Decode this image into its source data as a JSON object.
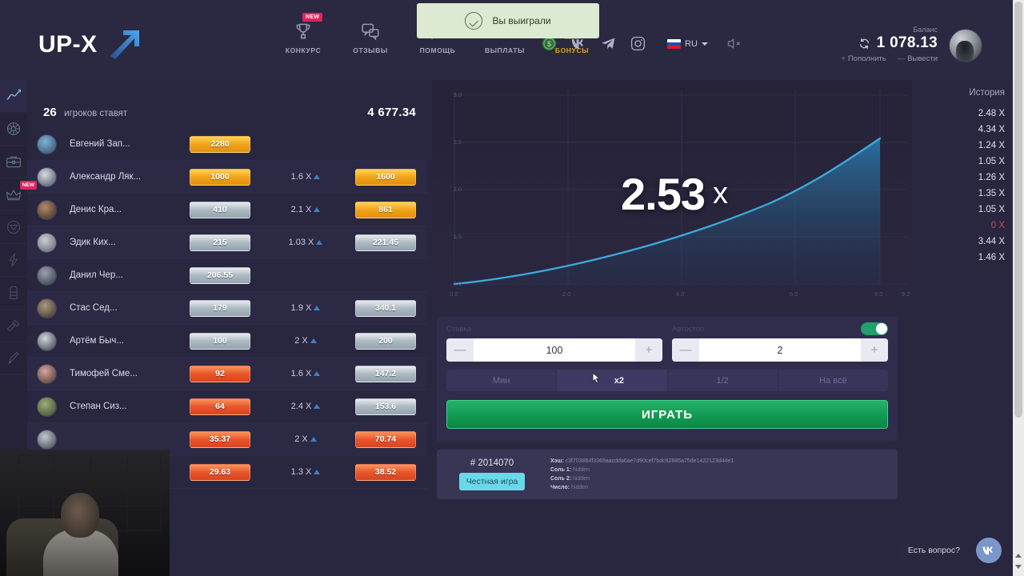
{
  "brand": {
    "name": "UP-X",
    "arrow_icon": "arrow-up-right-icon"
  },
  "toast": {
    "icon": "check-circle-icon",
    "message": "Вы выиграли"
  },
  "nav": {
    "items": [
      {
        "label": "КОНКУРС",
        "icon": "trophy-icon",
        "badge": "NEW",
        "active": false
      },
      {
        "label": "ОТЗЫВЫ",
        "icon": "chat-bubbles-icon",
        "badge": "",
        "active": false
      },
      {
        "label": "ПОМОЩЬ",
        "icon": "question-bubble-icon",
        "badge": "",
        "active": false
      },
      {
        "label": "ВЫПЛАТЫ",
        "icon": "cash-icon",
        "badge": "",
        "active": false
      },
      {
        "label": "БОНУСЫ",
        "icon": "gift-icon",
        "badge": "",
        "active": true
      }
    ],
    "social": [
      {
        "name": "money-coin-icon"
      },
      {
        "name": "vk-icon"
      },
      {
        "name": "telegram-icon"
      },
      {
        "name": "instagram-icon"
      }
    ],
    "language": {
      "code": "RU",
      "flag": "ru-flag-icon",
      "chevron": "chevron-down-icon"
    },
    "sound": {
      "icon": "sound-muted-icon"
    }
  },
  "account": {
    "balance_label": "Баланс",
    "balance_value": "1 078.13",
    "refresh_icon": "refresh-icon",
    "deposit_label": "Пополнить",
    "deposit_sign": "+",
    "withdraw_label": "Вывести",
    "withdraw_sign": "—",
    "avatar": "user-avatar"
  },
  "rail": {
    "items": [
      {
        "name": "crash-game",
        "icon": "chart-line-icon",
        "active": true,
        "badge": ""
      },
      {
        "name": "wheel-game",
        "icon": "wheel-icon",
        "active": false,
        "badge": ""
      },
      {
        "name": "case-game",
        "icon": "briefcase-icon",
        "active": false,
        "badge": ""
      },
      {
        "name": "crown-game",
        "icon": "crown-icon",
        "active": false,
        "badge": "NEW"
      },
      {
        "name": "diamond-game",
        "icon": "diamond-icon",
        "active": false,
        "badge": ""
      },
      {
        "name": "lightning-game",
        "icon": "lightning-icon",
        "active": false,
        "badge": ""
      },
      {
        "name": "tower-game",
        "icon": "tower-icon",
        "active": false,
        "badge": ""
      },
      {
        "name": "hammer-game",
        "icon": "hammer-icon",
        "active": false,
        "badge": ""
      },
      {
        "name": "rocket-game",
        "icon": "rocket-icon",
        "active": false,
        "badge": ""
      }
    ]
  },
  "players": {
    "count": "26",
    "count_label": "игроков ставят",
    "total": "4 677.34",
    "rows": [
      {
        "name": "Евгений Зап...",
        "bet": "2280",
        "bet_color": "gold",
        "mult": "",
        "win": "",
        "win_color": ""
      },
      {
        "name": "Александр Ляк...",
        "bet": "1000",
        "bet_color": "gold",
        "mult": "1.6 X",
        "win": "1600",
        "win_color": "gold"
      },
      {
        "name": "Денис Кра...",
        "bet": "410",
        "bet_color": "silver",
        "mult": "2.1 X",
        "win": "861",
        "win_color": "gold"
      },
      {
        "name": "Эдик Ких...",
        "bet": "215",
        "bet_color": "silver",
        "mult": "1.03 X",
        "win": "221.45",
        "win_color": "silver"
      },
      {
        "name": "Данил Чер...",
        "bet": "206.55",
        "bet_color": "silver",
        "mult": "",
        "win": "",
        "win_color": ""
      },
      {
        "name": "Стас Сед...",
        "bet": "179",
        "bet_color": "silver",
        "mult": "1.9 X",
        "win": "340.1",
        "win_color": "silver"
      },
      {
        "name": "Артём Быч...",
        "bet": "100",
        "bet_color": "silver",
        "mult": "2 X",
        "win": "200",
        "win_color": "silver"
      },
      {
        "name": "Тимофей Сме...",
        "bet": "92",
        "bet_color": "red",
        "mult": "1.6 X",
        "win": "147.2",
        "win_color": "silver"
      },
      {
        "name": "Степан Сиз...",
        "bet": "64",
        "bet_color": "red",
        "mult": "2.4 X",
        "win": "153.6",
        "win_color": "silver"
      },
      {
        "name": "",
        "bet": "35.37",
        "bet_color": "red",
        "mult": "2 X",
        "win": "70.74",
        "win_color": "red"
      },
      {
        "name": "",
        "bet": "29.63",
        "bet_color": "red",
        "mult": "1.3 X",
        "win": "38.52",
        "win_color": "red"
      }
    ]
  },
  "chart_data": {
    "type": "line",
    "title": "",
    "multiplier_display": "2.53",
    "multiplier_suffix": "x",
    "x": [
      0.0,
      1.0,
      2.0,
      3.0,
      4.0,
      5.0,
      6.0,
      7.0,
      7.9
    ],
    "y": [
      1.0,
      1.1,
      1.22,
      1.36,
      1.52,
      1.71,
      1.95,
      2.22,
      2.53
    ],
    "xlabel": "",
    "ylabel": "",
    "xlim": [
      0.0,
      9.2
    ],
    "ylim": [
      1.0,
      3.0
    ],
    "xticks": [
      "0.0",
      "2.0",
      "4.0",
      "6.0",
      "8.0",
      "9.2"
    ],
    "yticks": [
      "1.0",
      "1.5",
      "2.0",
      "2.5",
      "3.0"
    ],
    "grid": true,
    "line_color": "#3fa9dd",
    "fill_color": "#1d6f9e",
    "legend": []
  },
  "bet": {
    "stake_label": "Ставка",
    "stake_value": "100",
    "autostop_label": "Автостоп",
    "autostop_value": "2",
    "autostop_enabled": true,
    "minus_sign": "—",
    "plus_sign": "+",
    "quick": [
      {
        "label": "Мин",
        "hover": false
      },
      {
        "label": "x2",
        "hover": true
      },
      {
        "label": "1/2",
        "hover": false
      },
      {
        "label": "На всё",
        "hover": false
      }
    ],
    "play_label": "ИГРАТЬ"
  },
  "fair": {
    "game_id": "# 2014070",
    "button_label": "Честная игра",
    "fields": [
      {
        "label": "Хэш:",
        "value": "c3f703884f3369aacdda6ae7d90cef7bdc92885a75de1422123d44e1"
      },
      {
        "label": "Соль 1:",
        "value": "hidden"
      },
      {
        "label": "Соль 2:",
        "value": "hidden"
      },
      {
        "label": "Число:",
        "value": "hidden"
      }
    ]
  },
  "history": {
    "title": "История",
    "items": [
      {
        "value": "2.48 X",
        "crashed": false
      },
      {
        "value": "4.34 X",
        "crashed": false
      },
      {
        "value": "1.24 X",
        "crashed": false
      },
      {
        "value": "1.05 X",
        "crashed": false
      },
      {
        "value": "1.26 X",
        "crashed": false
      },
      {
        "value": "1.35 X",
        "crashed": false
      },
      {
        "value": "1.05 X",
        "crashed": false
      },
      {
        "value": "0 X",
        "crashed": true
      },
      {
        "value": "3.44 X",
        "crashed": false
      },
      {
        "value": "1.46 X",
        "crashed": false
      }
    ]
  },
  "support": {
    "text": "Есть вопрос?",
    "icon": "vk-icon"
  },
  "colors": {
    "accent_gold": "#e0a226",
    "green": "#129a52",
    "blue_line": "#3fa9dd",
    "crash_red": "#c94a57",
    "bg": "#292640"
  }
}
